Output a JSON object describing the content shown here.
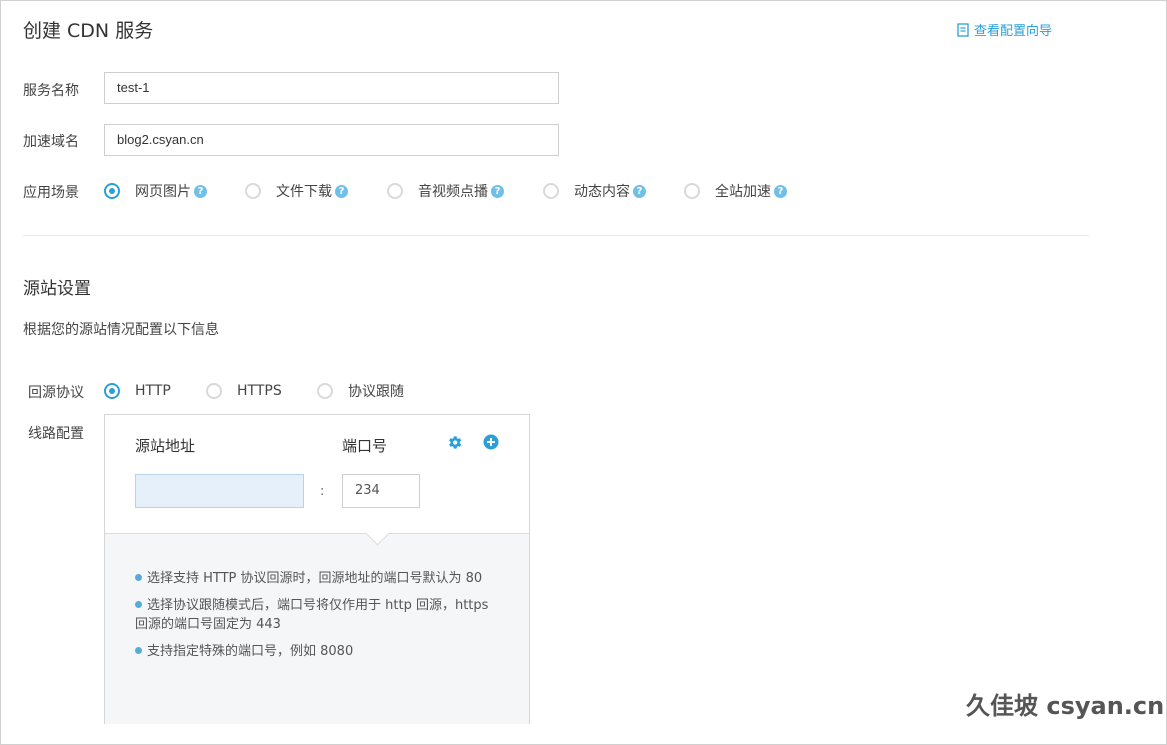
{
  "header": {
    "title": "创建 CDN 服务",
    "guide_link": "查看配置向导"
  },
  "form": {
    "service_name_label": "服务名称",
    "service_name_value": "test-1",
    "domain_label": "加速域名",
    "domain_value": "blog2.csyan.cn",
    "scenario_label": "应用场景",
    "scenarios": [
      {
        "label": "网页图片",
        "checked": true
      },
      {
        "label": "文件下载",
        "checked": false
      },
      {
        "label": "音视频点播",
        "checked": false
      },
      {
        "label": "动态内容",
        "checked": false
      },
      {
        "label": "全站加速",
        "checked": false
      }
    ],
    "help_glyph": "?"
  },
  "origin": {
    "section_title": "源站设置",
    "section_desc": "根据您的源站情况配置以下信息",
    "protocol_label": "回源协议",
    "protocols": [
      {
        "label": "HTTP",
        "checked": true
      },
      {
        "label": "HTTPS",
        "checked": false
      },
      {
        "label": "协议跟随",
        "checked": false
      }
    ],
    "line_label": "线路配置",
    "addr_header": "源站地址",
    "port_header": "端口号",
    "addr_value": "",
    "colon": ":",
    "port_value": "234",
    "icons": {
      "settings": "gear-icon",
      "add": "plus-circle-icon"
    },
    "tips": [
      "选择支持 HTTP 协议回源时，回源地址的端口号默认为 80",
      "选择协议跟随模式后，端口号将仅作用于 http 回源，https 回源的端口号固定为 443",
      "支持指定特殊的端口号，例如 8080"
    ]
  },
  "watermark": "久佳坡 csyan.cn",
  "colors": {
    "accent": "#2a9fd8",
    "help_icon": "#6fc0e8",
    "tip_bg": "#f5f6f8"
  }
}
